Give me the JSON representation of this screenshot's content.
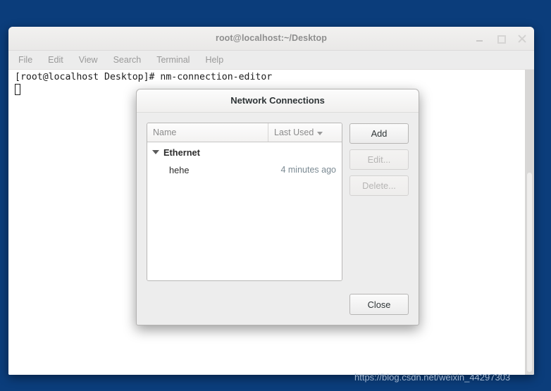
{
  "desktop": {
    "background_color": "#0b3d7b"
  },
  "terminal": {
    "title": "root@localhost:~/Desktop",
    "window_controls": [
      {
        "name": "minimize",
        "glyph": "_"
      },
      {
        "name": "maximize",
        "glyph": "□"
      },
      {
        "name": "close",
        "glyph": "×"
      }
    ],
    "menu": [
      {
        "label": "File"
      },
      {
        "label": "Edit"
      },
      {
        "label": "View"
      },
      {
        "label": "Search"
      },
      {
        "label": "Terminal"
      },
      {
        "label": "Help"
      }
    ],
    "prompt_line": "[root@localhost Desktop]# nm-connection-editor",
    "cursor": "block-outline-cursor"
  },
  "dialog": {
    "title": "Network Connections",
    "list": {
      "columns": [
        {
          "key": "name",
          "label": "Name"
        },
        {
          "key": "last_used",
          "label": "Last Used",
          "sort_indicator": "chevron-down-icon"
        }
      ],
      "groups": [
        {
          "label": "Ethernet",
          "expanded": true,
          "rows": [
            {
              "name": "hehe",
              "last_used": "4 minutes ago"
            }
          ]
        }
      ]
    },
    "side_buttons": [
      {
        "label": "Add",
        "enabled": true
      },
      {
        "label": "Edit...",
        "enabled": false
      },
      {
        "label": "Delete...",
        "enabled": false
      }
    ],
    "close_label": "Close"
  },
  "watermark": {
    "text": "https://blog.csdn.net/weixin_44297303",
    "color": "#9fb4cf"
  }
}
